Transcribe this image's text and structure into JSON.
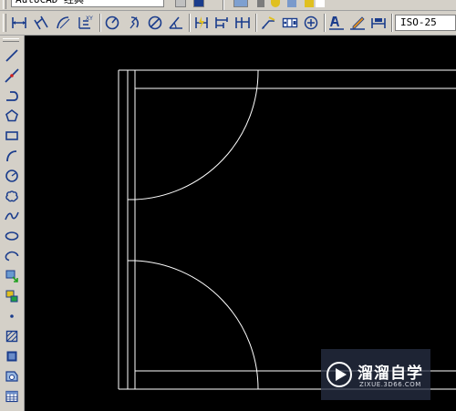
{
  "top_toolbar": {
    "layer_combo_value": "AutoCAD 经典"
  },
  "dimension_toolbar": {
    "buttons": [
      {
        "name": "linear-dimension",
        "icon": "linear-dim-icon"
      },
      {
        "name": "aligned-dimension",
        "icon": "aligned-dim-icon"
      },
      {
        "name": "arc-length",
        "icon": "arc-length-icon"
      },
      {
        "name": "ordinate-dimension",
        "icon": "ordinate-dim-icon"
      },
      {
        "name": "radius-dimension",
        "icon": "radius-dim-icon"
      },
      {
        "name": "jogged-dimension",
        "icon": "jogged-dim-icon"
      },
      {
        "name": "diameter-dimension",
        "icon": "diameter-dim-icon"
      },
      {
        "name": "angular-dimension",
        "icon": "angular-dim-icon"
      },
      {
        "name": "quick-dimension",
        "icon": "quick-dim-icon"
      },
      {
        "name": "baseline-dimension",
        "icon": "baseline-dim-icon"
      },
      {
        "name": "continue-dimension",
        "icon": "continue-dim-icon"
      },
      {
        "name": "quick-leader",
        "icon": "leader-icon"
      },
      {
        "name": "tolerance",
        "icon": "tolerance-icon"
      },
      {
        "name": "center-mark",
        "icon": "center-mark-icon"
      },
      {
        "name": "dimension-edit",
        "icon": "dim-edit-icon"
      },
      {
        "name": "dimension-text-edit",
        "icon": "dim-text-edit-icon"
      },
      {
        "name": "dimension-update",
        "icon": "dim-update-icon"
      }
    ],
    "dimstyle_value": "ISO-25"
  },
  "draw_toolbar": {
    "buttons": [
      "line",
      "construction-line",
      "polyline",
      "polygon",
      "rectangle",
      "arc",
      "circle",
      "revision-cloud",
      "spline",
      "ellipse",
      "ellipse-arc",
      "insert-block",
      "make-block",
      "point",
      "hatch",
      "gradient",
      "region",
      "table"
    ]
  },
  "watermark": {
    "title": "溜溜自学",
    "url": "ZIXUE.3D66.COM"
  },
  "colors": {
    "canvas_bg": "#000000",
    "geometry": "#ffffff",
    "toolbar_bg": "#d4d0c8",
    "icon_blue": "#1a3c8c"
  }
}
